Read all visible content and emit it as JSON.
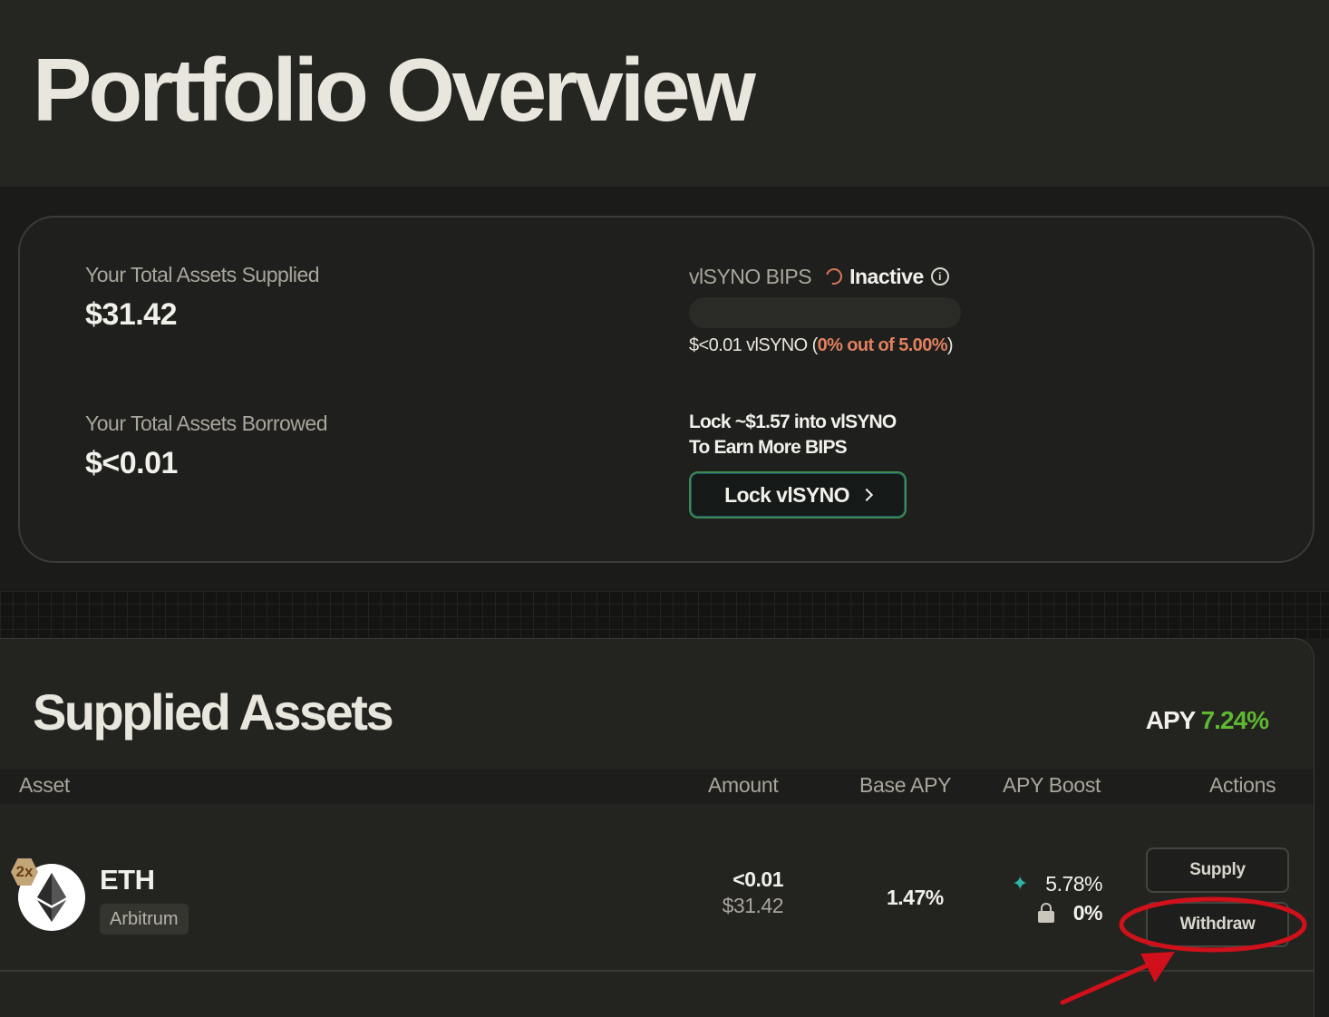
{
  "page": {
    "title": "Portfolio Overview"
  },
  "summary": {
    "supplied_label": "Your Total Assets Supplied",
    "supplied_value": "$31.42",
    "borrowed_label": "Your Total Assets Borrowed",
    "borrowed_value": "$<0.01",
    "bips_label": "vlSYNO BIPS",
    "bips_status": "Inactive",
    "bips_progress_fraction": 0,
    "visyno_amount": "$<0.01 vlSYNO (",
    "visyno_progress_text": "0% out of 5.00%",
    "visyno_close": ")",
    "lock_message_line1": "Lock ~$1.57 into vlSYNO",
    "lock_message_line2": "To Earn More BIPS",
    "lock_button_label": "Lock vlSYNO"
  },
  "supplied_assets": {
    "title": "Supplied Assets",
    "apy_label": "APY",
    "apy_value": "7.24%",
    "columns": {
      "asset": "Asset",
      "amount": "Amount",
      "base_apy": "Base APY",
      "apy_boost": "APY Boost",
      "actions": "Actions"
    },
    "rows": [
      {
        "badge": "2x",
        "icon": "ethereum-icon",
        "name": "ETH",
        "chain": "Arbitrum",
        "amount": "<0.01",
        "amount_usd": "$31.42",
        "base_apy": "1.47%",
        "boost_apy": "5.78%",
        "locked_apy": "0%",
        "supply_label": "Supply",
        "withdraw_label": "Withdraw"
      }
    ]
  },
  "colors": {
    "accent_orange": "#e0805f",
    "apy_green": "#5fb832",
    "annotation_red": "#d0101a"
  }
}
